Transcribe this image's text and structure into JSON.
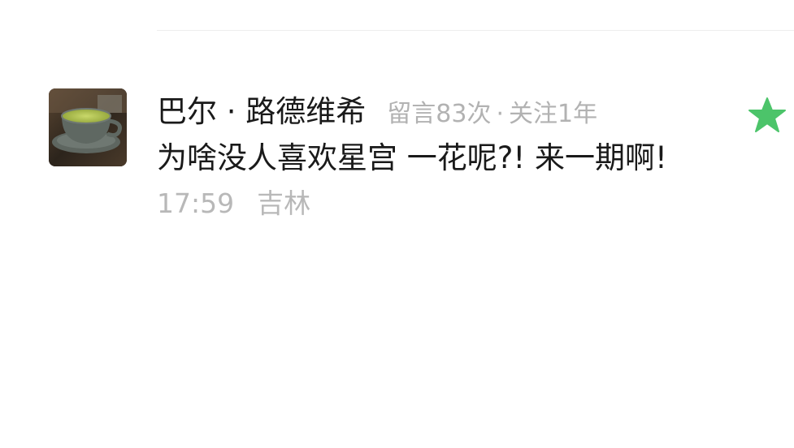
{
  "comment": {
    "username": "巴尔 · 路德维希",
    "meta": {
      "messages": "留言83次",
      "separator": "·",
      "follow": "关注1年"
    },
    "text": "为啥没人喜欢星宫 一花呢?!  来一期啊!",
    "time": "17:59",
    "location": "吉林",
    "star_color": "#4cc46a",
    "icons": {
      "avatar": "coffee-cup-avatar",
      "star": "star-icon"
    }
  }
}
